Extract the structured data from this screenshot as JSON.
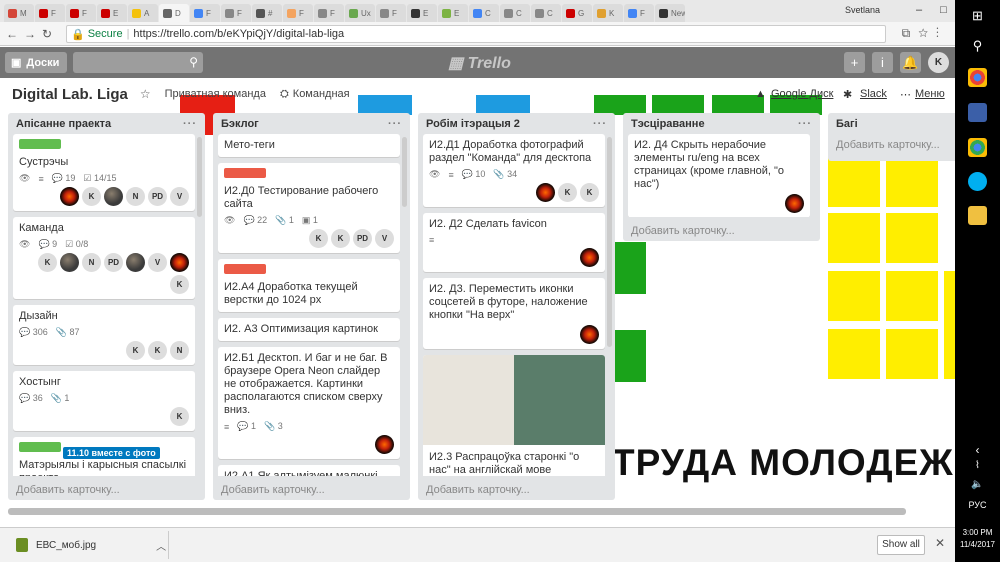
{
  "browser": {
    "tabs": [
      "M",
      "F",
      "F",
      "E",
      "A",
      "D",
      "F",
      "F",
      "#",
      "F",
      "F",
      "Ux",
      "F",
      "E",
      "E",
      "C",
      "C",
      "C",
      "G",
      "K",
      "F",
      "New"
    ],
    "tab_colors": [
      "#d44638",
      "#cc0000",
      "#cc0000",
      "#cc0000",
      "#f4c20d",
      "#666666",
      "#4285f4",
      "#888888",
      "#555555",
      "#f4a460",
      "#888888",
      "#6aa84f",
      "#888888",
      "#333333",
      "#7cb342",
      "#4285f4",
      "#888888",
      "#888888",
      "#cc0000",
      "#e0a030",
      "#4285f4",
      "#333333",
      "#d44638",
      "#aaaaaa"
    ],
    "user": "Svetlana",
    "secure_label": "Secure",
    "url": "https://trello.com/b/eKYpiQjY/digital-lab-liga"
  },
  "topbar": {
    "boards_label": "Доски",
    "logo": "Trello",
    "user_initial": "K"
  },
  "board": {
    "title": "Digital Lab. Liga",
    "team": "Приватная команда",
    "visibility": "Командная",
    "google_drive": "Google Диск",
    "slack": "Slack",
    "menu": "Меню"
  },
  "background_text": "ТРУДА МОЛОДЕЖ",
  "add_card": "Добавить карточку...",
  "lists": [
    {
      "name": "Апісанне праекта",
      "cards": [
        {
          "labels": [
            {
              "color": "#61bd4f",
              "text": ""
            }
          ],
          "title": "Сустрэчы",
          "badges": [
            "👁",
            "≡",
            "💬 19",
            "☑ 14/15"
          ],
          "members": [
            "fire",
            "K",
            "photo",
            "N",
            "PD",
            "V"
          ]
        },
        {
          "labels": [],
          "title": "Каманда",
          "badges": [
            "👁",
            "💬 9",
            "☑ 0/8"
          ],
          "members": [
            "K",
            "photo",
            "N",
            "PD",
            "photo",
            "V",
            "fire",
            "K"
          ]
        },
        {
          "labels": [],
          "title": "Дызайн",
          "badges": [
            "💬 306",
            "📎 87"
          ],
          "members": [
            "K",
            "K",
            "N"
          ]
        },
        {
          "labels": [],
          "title": "Хостынг",
          "badges": [
            "💬 36",
            "📎 1"
          ],
          "members": [
            "K"
          ]
        },
        {
          "labels": [
            {
              "color": "#61bd4f",
              "text": ""
            },
            {
              "color": "#0079bf",
              "text": "11.10 вместе с фото"
            }
          ],
          "title": "Матэрыялы і карысныя спасылкі праекта",
          "badges": [],
          "members": []
        }
      ]
    },
    {
      "name": "Бэклог",
      "cards": [
        {
          "labels": [],
          "title": "Мето-теги",
          "badges": [],
          "members": []
        },
        {
          "labels": [
            {
              "color": "#eb5a46",
              "text": ""
            }
          ],
          "title": "И2.Д0 Тестирование рабочего сайта",
          "badges": [
            "👁",
            "💬 22",
            "📎 1",
            "▣ 1"
          ],
          "members": [
            "K",
            "K",
            "PD",
            "V"
          ]
        },
        {
          "labels": [
            {
              "color": "#eb5a46",
              "text": ""
            }
          ],
          "title": "И2.А4 Доработка текущей верстки до 1024 px",
          "badges": [],
          "members": []
        },
        {
          "labels": [],
          "title": "И2. А3 Оптимизация картинок",
          "badges": [],
          "members": []
        },
        {
          "labels": [],
          "title": "И2.Б1 Десктоп. И баг и не баг. В браузере Opera Neon слайдер не отображается. Картинки располагаются списком сверху вниз.",
          "badges": [
            "≡",
            "💬 1",
            "📎 3"
          ],
          "members": [
            "fire"
          ]
        },
        {
          "labels": [],
          "title": "И2.А1 Як алтымізуем малюнкі",
          "badges": [],
          "members": []
        }
      ]
    },
    {
      "name": "Робім ітэрацыя 2",
      "cards": [
        {
          "labels": [],
          "title": "И2.Д1 Доработка фотографий раздел \"Команда\" для десктопа",
          "badges": [
            "👁",
            "≡",
            "💬 10",
            "📎 34"
          ],
          "members": [
            "fire",
            "K",
            "K"
          ]
        },
        {
          "labels": [],
          "title": "И2. Д2 Сделать favicon",
          "badges": [
            "≡"
          ],
          "members": [
            "fire"
          ]
        },
        {
          "labels": [],
          "title": "И2. Д3. Переместить иконки соцсетей в футоре, наложение кнопки \"На верх\"",
          "badges": [],
          "members": [
            "fire"
          ]
        },
        {
          "labels": [],
          "title": "И2.3 Распрацоўка старонкі \"о нас\" на англійскай мове",
          "badges": [],
          "members": [],
          "image": true
        }
      ]
    },
    {
      "name": "Тэсціраванне",
      "cards": [
        {
          "labels": [],
          "title": "И2. Д4 Скрыть нерабочие элементы ru/eng на всех страницах (кроме главной, \"о нас\")",
          "badges": [],
          "members": [
            "fire"
          ]
        }
      ]
    },
    {
      "name": "Багі",
      "cards": []
    }
  ],
  "download": {
    "filename": "ЕВС_моб.jpg",
    "show_all": "Show all"
  },
  "taskbar": {
    "lang": "РУС",
    "time": "3:00 PM",
    "date": "11/4/2017"
  },
  "colors": {
    "green": "#61bd4f",
    "red": "#eb5a46",
    "blue": "#0079bf",
    "bg_yellow": "#ffee00",
    "bg_green": "#1aa31a",
    "bg_red": "#e61f14",
    "bg_blue": "#1e9be0"
  }
}
